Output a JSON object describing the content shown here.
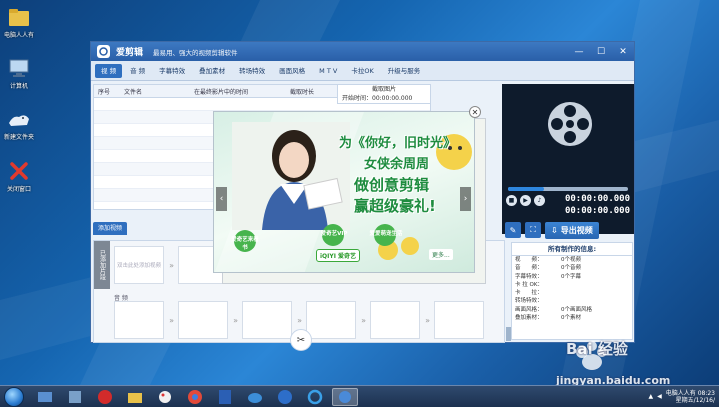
{
  "desktop": {
    "icons": [
      "电脑人人有",
      "计算机",
      "新建文件夹",
      "关闭窗口"
    ]
  },
  "app": {
    "title": "爱剪辑",
    "slogan": "最易用、强大的视频剪辑软件",
    "controls": {
      "minimize": "—",
      "maximize": "☐",
      "close": "✕"
    },
    "tabs": [
      "视 频",
      "音 频",
      "字幕特效",
      "叠加素材",
      "转场特效",
      "画面风格",
      "M T V",
      "卡拉OK",
      "升级与服务"
    ],
    "table_headers": [
      "序号",
      "文件名",
      "在最终影片中的时间",
      "截取时长"
    ],
    "preview_panel": {
      "title": "截取图片",
      "start_label": "开始时间：",
      "start_time": "00:00:00.000"
    },
    "player": {
      "time_current": "00:00:00.000",
      "time_total": "00:00:00.000"
    },
    "add_video_tab": "添加视频",
    "export_button": "导出视频",
    "info": {
      "title": "所有制作的信息:",
      "rows": [
        {
          "k": "视　　频：",
          "v": "0个视频"
        },
        {
          "k": "音　　频：",
          "v": "0个音频"
        },
        {
          "k": "字幕特效：",
          "v": "0个字幕"
        },
        {
          "k": "卡 拉 OK：",
          "v": ""
        },
        {
          "k": "卡　　拉：",
          "v": ""
        },
        {
          "k": "转场特效：",
          "v": ""
        },
        {
          "k": "画面风格：",
          "v": "0个画面风格"
        },
        {
          "k": "叠加素材：",
          "v": "0个素材"
        }
      ]
    },
    "timeline": {
      "side_label": "已添加片段",
      "first_clip_hint": "双击此处添加视频",
      "music_label": "音 频"
    }
  },
  "ad": {
    "line1": "为《你好，旧时光》",
    "line2": "女侠余周周",
    "line3": "做创意剪辑",
    "line4": "赢超级豪礼!",
    "more": "更多...",
    "brand": "iQIYI 爱奇艺",
    "badge1": "爱奇艺来看书",
    "badge2": "爱奇艺VIP",
    "badge3": "爱爱萌宠生活",
    "close": "✕",
    "prev": "‹",
    "next": "›"
  },
  "taskbar": {
    "clock_line1": "电脑人人有 08:23",
    "clock_line2": "星期五/12/16/"
  },
  "watermark": {
    "brand": "Bai 经验",
    "url": "jingyan.baidu.com"
  },
  "colors": {
    "accent": "#2f6fbf",
    "titlebar": "#2a5fa8",
    "ad_text": "#1e8c3f",
    "player_bg": "#0e1b2c"
  }
}
